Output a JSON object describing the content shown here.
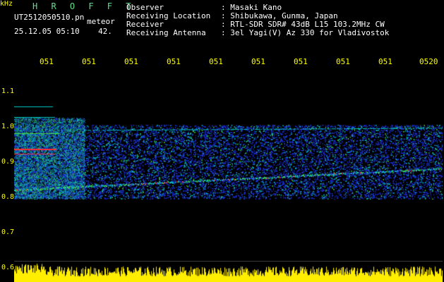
{
  "header": {
    "brand": "H R O F F T",
    "filename": "UT2512050510.pn",
    "tag": "meteor",
    "datetime": "25.12.05 05:10",
    "value": "42.",
    "info_labels": "Observer\nReceiving Location\nReceiver\nReceiving Antenna",
    "info_values": ": Masaki Kano\n: Shibukawa, Gunma, Japan\n: RTL-SDR SDR# 43dB L15 103.2MHz CW\n: 3el Yagi(V) Az 330 for Vladivostok"
  },
  "axis": {
    "unit": "kHz",
    "y_labels": [
      "1.1",
      "1.0",
      "0.9",
      "0.8",
      "0.7",
      "0.6"
    ],
    "x_labels": [
      "051",
      "051",
      "051",
      "051",
      "051",
      "051",
      "051",
      "051",
      "051",
      "0520"
    ]
  },
  "colors": {
    "background": "#000000",
    "axis_text": "#ffff00",
    "brand_text": "#5fe08a",
    "noise_low": "#1e32d8",
    "noise_mid": "#00c8c8",
    "noise_high": "#4ae04a",
    "signal_hot": "#ff3030",
    "activity_bar": "#ffee00"
  }
}
